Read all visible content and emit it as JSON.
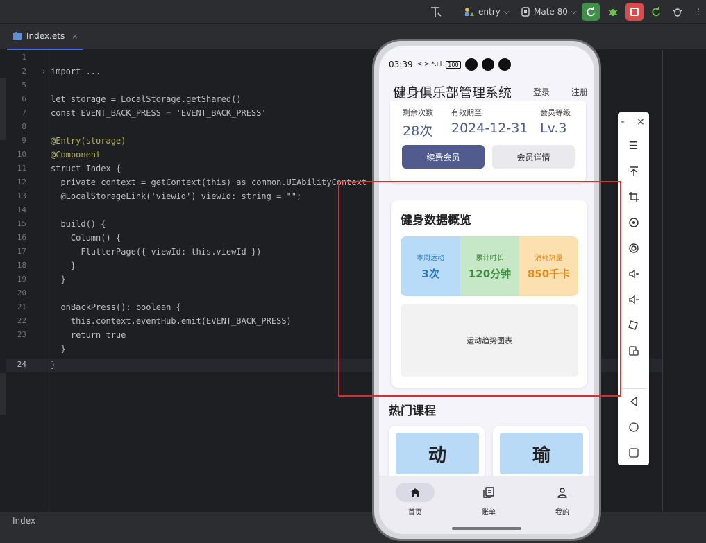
{
  "toolbar": {
    "run_config": "entry",
    "device": "Mate 80",
    "colors": {
      "run_green": "#3f8f4a",
      "stop_red": "#d94c4c"
    }
  },
  "editor_tab": {
    "filename": "Index.ets",
    "close": "×"
  },
  "code": {
    "line_numbers": [
      "1",
      "2",
      "5",
      "6",
      "7",
      "8",
      "9",
      "10",
      "11",
      "12",
      "13",
      "14",
      "15",
      "16",
      "17",
      "18",
      "19",
      "20",
      "21",
      "22",
      "23",
      "24"
    ],
    "lines": [
      "",
      "import ...",
      "let storage = LocalStorage.getShared()",
      "const EVENT_BACK_PRESS = 'EVENT_BACK_PRESS'",
      "",
      "@Entry(storage)",
      "@Component",
      "struct Index {",
      "  private context = getContext(this) as common.UIAbilityContext",
      "  @LocalStorageLink('viewId') viewId: string = \"\";",
      "",
      "  build() {",
      "    Column() {",
      "      FlutterPage({ viewId: this.viewId })",
      "    }",
      "  }",
      "",
      "  onBackPress(): boolean {",
      "    this.context.eventHub.emit(EVENT_BACK_PRESS)",
      "    return true",
      "  }",
      "}"
    ]
  },
  "statusbar": {
    "text": "Index"
  },
  "phone": {
    "status": {
      "time": "03:39",
      "signal": "<·> *.ıll",
      "battery": "100"
    },
    "app": {
      "title": "健身俱乐部管理系统",
      "login": "登录",
      "register": "注册"
    },
    "membership": {
      "labels": [
        "剩余次数",
        "有效期至",
        "会员等级"
      ],
      "values": [
        "28次",
        "2024-12-31",
        "Lv.3"
      ],
      "renew_button": "续费会员",
      "details_button": "会员详情"
    },
    "overview": {
      "title": "健身数据概览",
      "stats": [
        {
          "label": "本周运动",
          "value": "3次",
          "bg": "#b8dcf7",
          "fg": "#2877c8"
        },
        {
          "label": "累计时长",
          "value": "120分钟",
          "bg": "#c6e8c6",
          "fg": "#3d8b3f"
        },
        {
          "label": "消耗热量",
          "value": "850千卡",
          "bg": "#fde0b0",
          "fg": "#e28a1c"
        }
      ],
      "chart_placeholder": "运动趋势图表"
    },
    "courses": {
      "title": "热门课程",
      "items": [
        "动",
        "瑜"
      ]
    },
    "tabbar": [
      {
        "label": "首页",
        "icon": "home-icon"
      },
      {
        "label": "账单",
        "icon": "bill-icon"
      },
      {
        "label": "我的",
        "icon": "person-icon"
      }
    ]
  },
  "side_panel": {
    "minimize": "-",
    "close": "×"
  }
}
